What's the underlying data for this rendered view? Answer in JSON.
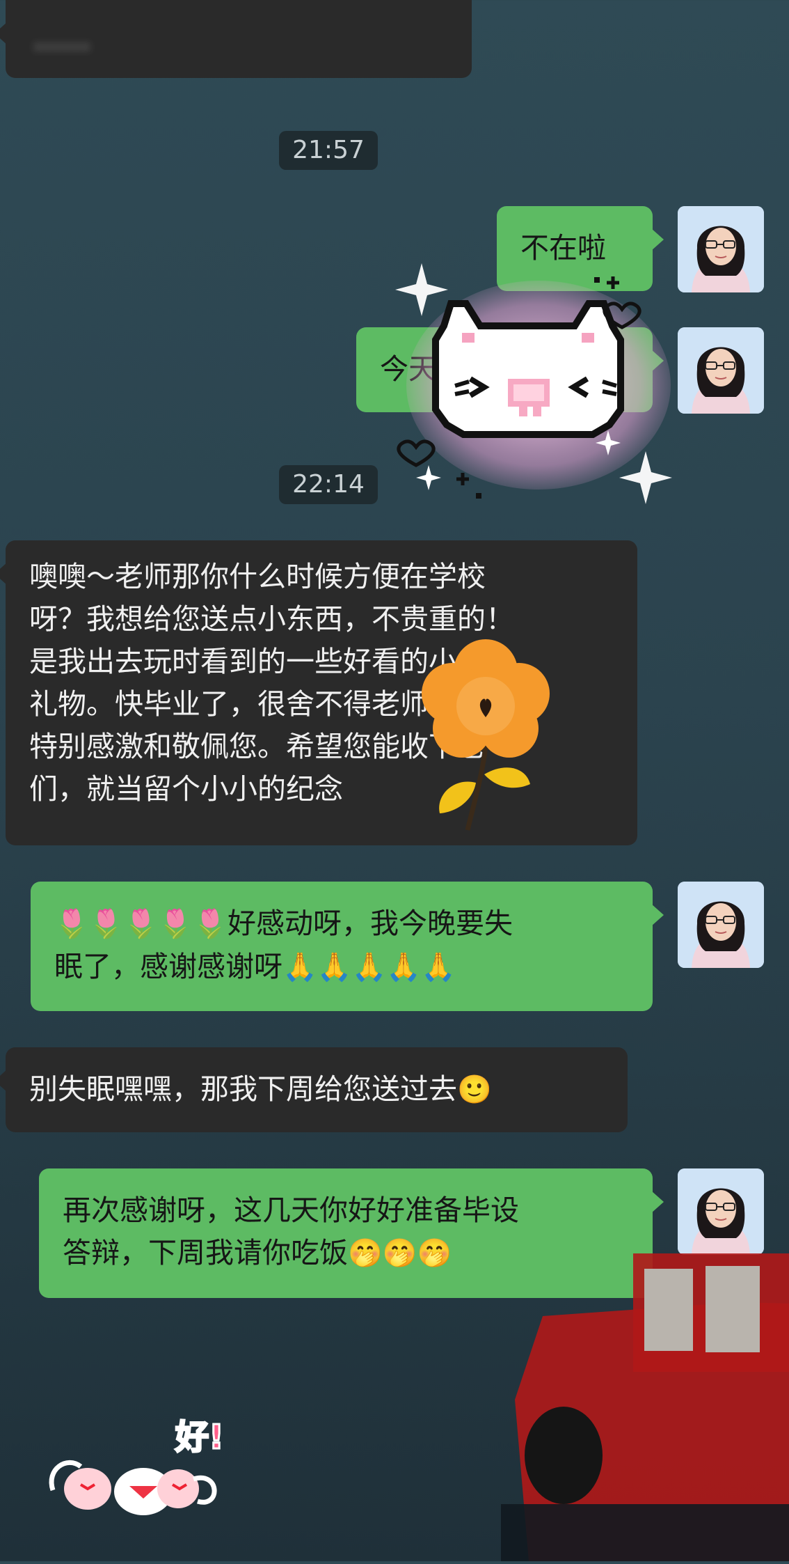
{
  "top_message": {
    "text": "……"
  },
  "timestamps": [
    "21:57",
    "22:14"
  ],
  "messages": {
    "m1": {
      "text": "不在啦"
    },
    "m2": {
      "text": "今天"
    },
    "m3": {
      "lines": [
        "噢噢～老师那你什么时候方便在学校",
        "呀？我想给您送点小东西，不贵重的！",
        "是我出去玩时看到的一些好看的小",
        "礼物。快毕业了，很舍不得老师，也",
        "特别感激和敬佩您。希望您能收下它",
        "们，就当留个小小的纪念"
      ]
    },
    "m4": {
      "line1_emoji": "🌷🌷🌷🌷🌷",
      "line1_text": "好感动呀，我今晚要失",
      "line2_text": "眠了，感谢感谢呀",
      "line2_emoji": "🙏🙏🙏🙏🙏"
    },
    "m5": {
      "text": "别失眠嘿嘿，那我下周给您送过去",
      "emoji": "🙂"
    },
    "m6": {
      "line1": "再次感谢呀，这几天你好好准备毕设",
      "line2_text": "答辩，下周我请你吃饭",
      "line2_emoji": "🤭🤭🤭"
    }
  },
  "stickers": {
    "hao": "好!"
  },
  "colors": {
    "me_bubble": "#5dbb63",
    "other_bubble": "#2a2a2a",
    "background": "#2b434e"
  }
}
